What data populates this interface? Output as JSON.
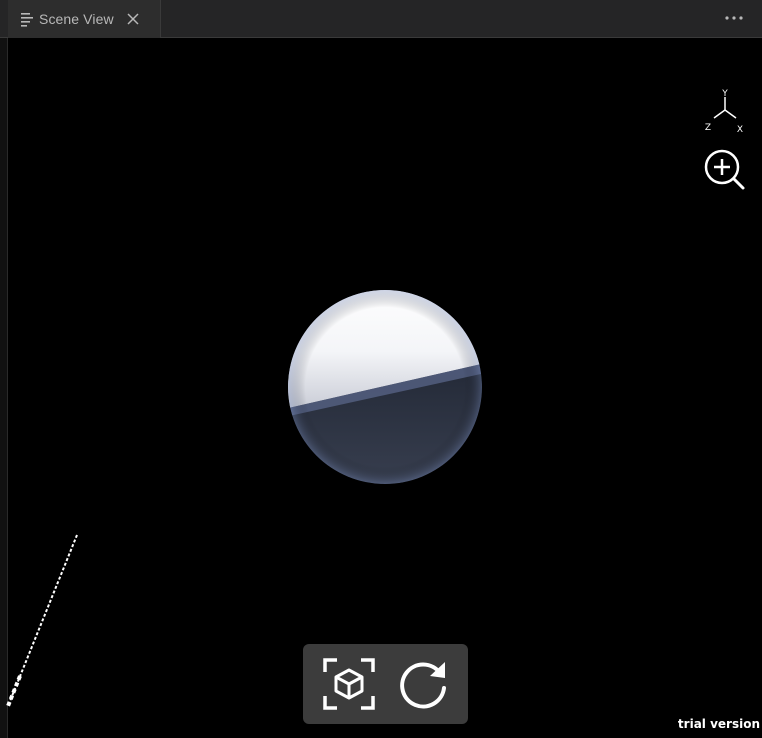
{
  "tab": {
    "label": "Scene View"
  },
  "gizmo": {
    "y_label": "Y",
    "z_label": "Z",
    "x_label": "X"
  },
  "watermark": "trial version",
  "colors": {
    "tabbar": "#252526",
    "tab": "#2d2d2d",
    "toolbar": "#3c3c3c",
    "viewport": "#000000",
    "sphere_light": "#ffffff",
    "sphere_dark": "#2b3550"
  },
  "icons": [
    "list-icon",
    "close-icon",
    "more-icon",
    "axis-gizmo-icon",
    "zoom-in-icon",
    "cube-focus-icon",
    "rotate-icon"
  ]
}
